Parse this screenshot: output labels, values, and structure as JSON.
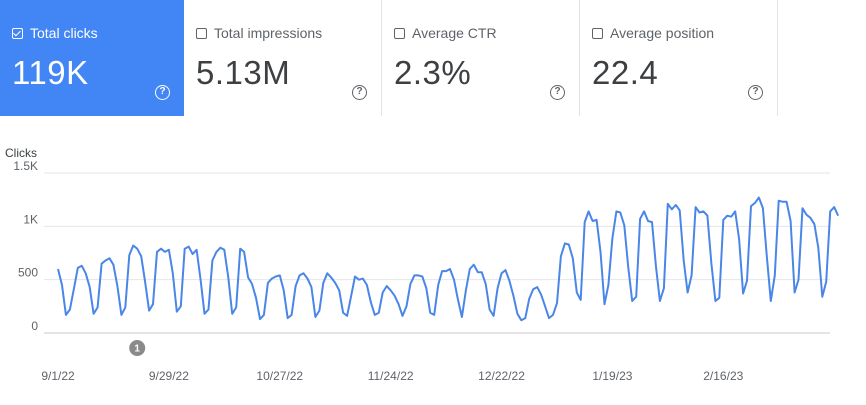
{
  "metrics": [
    {
      "label": "Total clicks",
      "value": "119K",
      "checked": true
    },
    {
      "label": "Total impressions",
      "value": "5.13M",
      "checked": false
    },
    {
      "label": "Average CTR",
      "value": "2.3%",
      "checked": false
    },
    {
      "label": "Average position",
      "value": "22.4",
      "checked": false
    }
  ],
  "help_glyph": "?",
  "annotation_marker": "1",
  "colors": {
    "accent": "#4285f4",
    "line": "#4a86e8",
    "grid": "#e6e6e6"
  },
  "chart_data": {
    "type": "line",
    "ylabel": "Clicks",
    "y_tick_labels": [
      "0",
      "500",
      "1K",
      "1.5K"
    ],
    "y_ticks": [
      0,
      500,
      1000,
      1500
    ],
    "ylim": [
      0,
      1500
    ],
    "x_tick_labels": [
      "9/1/22",
      "9/29/22",
      "10/27/22",
      "11/24/22",
      "12/22/22",
      "1/19/23",
      "2/16/23"
    ],
    "x_tick_index": [
      0,
      28,
      56,
      84,
      112,
      140,
      168
    ],
    "x_start": "9/1/22",
    "annotation_index": 20,
    "series": [
      {
        "values": [
          600,
          450,
          170,
          220,
          410,
          610,
          630,
          560,
          430,
          180,
          240,
          650,
          680,
          700,
          640,
          440,
          170,
          240,
          730,
          820,
          790,
          720,
          480,
          210,
          270,
          760,
          790,
          760,
          780,
          560,
          200,
          250,
          790,
          810,
          740,
          780,
          500,
          180,
          220,
          680,
          760,
          800,
          780,
          520,
          180,
          240,
          790,
          760,
          520,
          460,
          330,
          130,
          170,
          470,
          510,
          530,
          540,
          400,
          140,
          170,
          440,
          540,
          560,
          510,
          430,
          150,
          210,
          470,
          560,
          520,
          470,
          400,
          190,
          160,
          340,
          530,
          500,
          510,
          450,
          290,
          170,
          190,
          380,
          440,
          400,
          350,
          270,
          160,
          250,
          460,
          540,
          540,
          530,
          420,
          190,
          170,
          450,
          580,
          580,
          600,
          500,
          310,
          150,
          400,
          600,
          640,
          570,
          570,
          460,
          220,
          160,
          420,
          560,
          590,
          490,
          350,
          180,
          120,
          140,
          320,
          410,
          430,
          360,
          250,
          140,
          170,
          280,
          720,
          840,
          830,
          700,
          380,
          310,
          1040,
          1140,
          1050,
          1060,
          760,
          270,
          450,
          890,
          1140,
          1130,
          1010,
          620,
          300,
          340,
          1070,
          1140,
          1050,
          1040,
          620,
          300,
          420,
          1210,
          1160,
          1200,
          1150,
          680,
          380,
          540,
          1180,
          1130,
          1140,
          1100,
          650,
          300,
          330,
          1060,
          1100,
          1090,
          1140,
          880,
          370,
          490,
          1190,
          1220,
          1270,
          1170,
          720,
          300,
          540,
          1240,
          1230,
          1230,
          1050,
          380,
          500,
          1170,
          1110,
          1080,
          1020,
          800,
          340,
          480,
          1140,
          1180,
          1100
        ]
      }
    ]
  }
}
